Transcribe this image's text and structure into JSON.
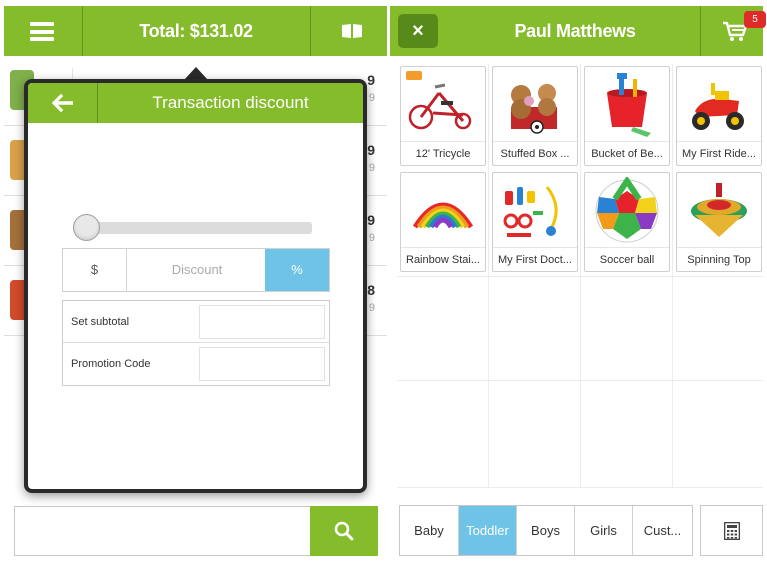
{
  "header_left": {
    "total_label": "Total: $131.02",
    "menu_icon": "hamburger-icon",
    "book_icon": "book-icon"
  },
  "header_right": {
    "customer_name": "Paul Matthews",
    "close_label": "×",
    "cart_icon": "cart-icon",
    "cart_count": "5"
  },
  "cart_rows": [
    {
      "price_main": "9",
      "price_sub": "9"
    },
    {
      "price_main": "9",
      "price_sub": "9"
    },
    {
      "price_main": "9",
      "price_sub": "9"
    },
    {
      "price_main": "8",
      "price_sub": "9"
    }
  ],
  "dialog": {
    "title": "Transaction discount",
    "back_icon": "arrow-left-icon",
    "slider_level": 0,
    "segment": {
      "dollar": "$",
      "discount_placeholder": "Discount",
      "percent": "%",
      "selected": "%"
    },
    "fields": {
      "subtotal_label": "Set subtotal",
      "subtotal_value": "",
      "promo_label": "Promotion Code",
      "promo_value": ""
    }
  },
  "search": {
    "placeholder": "",
    "icon": "search-icon"
  },
  "products": [
    {
      "label": "12' Tricycle",
      "image": "tricycle-image",
      "folder": true
    },
    {
      "label": "Stuffed Box ...",
      "image": "stuffed-toys-image",
      "folder": false
    },
    {
      "label": "Bucket of Be...",
      "image": "beach-bucket-image",
      "folder": false
    },
    {
      "label": "My First Ride...",
      "image": "ride-on-toy-image",
      "folder": false
    },
    {
      "label": "Rainbow Stai...",
      "image": "rainbow-slinky-image",
      "folder": false
    },
    {
      "label": "My First Doct...",
      "image": "doctor-kit-image",
      "folder": false
    },
    {
      "label": "Soccer ball",
      "image": "soccer-ball-image",
      "folder": false
    },
    {
      "label": "Spinning Top",
      "image": "spinning-top-image",
      "folder": false
    }
  ],
  "categories": [
    {
      "label": "Baby",
      "active": false
    },
    {
      "label": "Toddler",
      "active": true
    },
    {
      "label": "Boys",
      "active": false
    },
    {
      "label": "Girls",
      "active": false
    },
    {
      "label": "Cust...",
      "active": false
    }
  ],
  "calculator_icon": "calculator-icon",
  "colors": {
    "brand_green": "#84bc2c",
    "dark_green": "#578a18",
    "accent_blue": "#6ec3e6",
    "badge_red": "#e02a2a"
  }
}
